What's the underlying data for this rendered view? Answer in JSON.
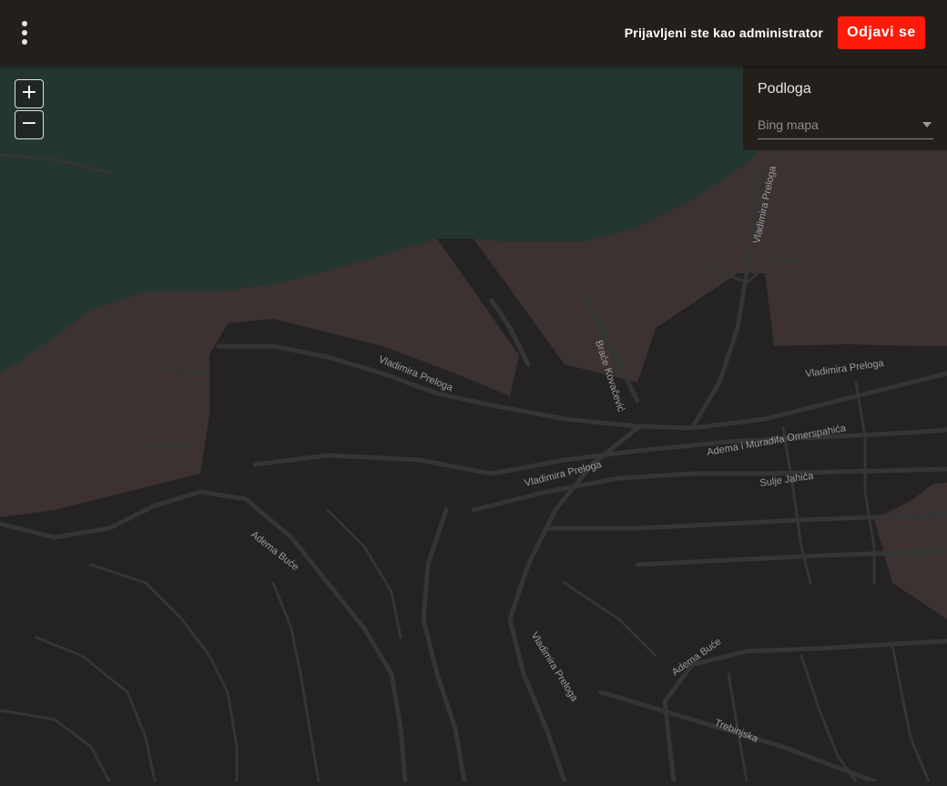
{
  "header": {
    "menu_icon": "more-vertical-icon",
    "user_status": "Prijavljeni ste kao administrator",
    "logout_label": "Odjavi se",
    "logout_color": "#ff1a0a"
  },
  "map_controls": {
    "zoom_in_label": "+",
    "zoom_out_label": "−"
  },
  "layer_panel": {
    "title": "Podloga",
    "selected_layer": "Bing mapa"
  },
  "map": {
    "colors": {
      "water": "#243630",
      "land": "#3b3231",
      "urban": "#242222",
      "roads": "#353535"
    },
    "street_labels": [
      "Vladimira Preloga",
      "Vladimira Preloga",
      "Braće Kovačević",
      "Vladimira Preloga",
      "Adema i Muradifa Omerspahića",
      "Sulje Jahića",
      "Vladimira Preloga",
      "Adema Buće",
      "Vladimira Preloga",
      "Adema Buće",
      "Trebinjska"
    ]
  }
}
